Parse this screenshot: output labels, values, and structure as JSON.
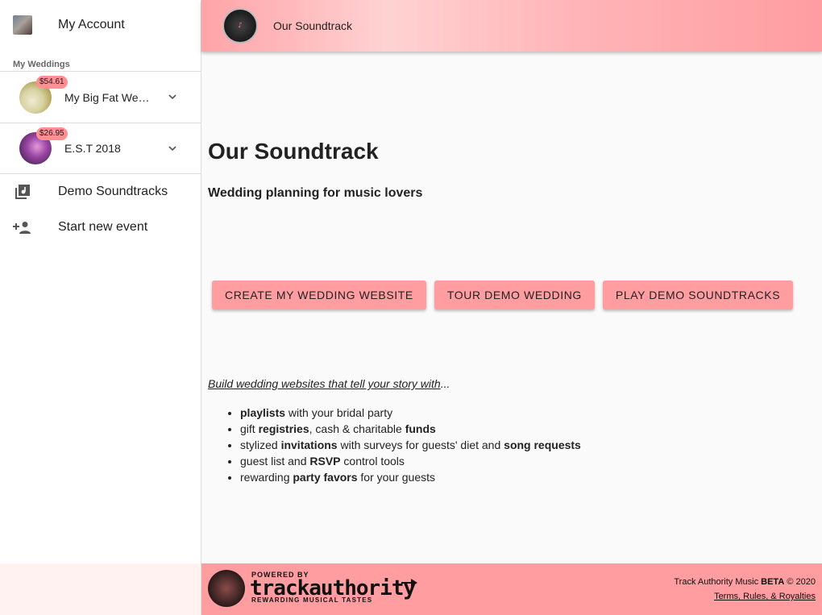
{
  "sidebar": {
    "account_label": "My Account",
    "section_title": "My Weddings",
    "weddings": [
      {
        "name": "My Big Fat Wedding",
        "price": "$54.61"
      },
      {
        "name": "E.S.T 2018",
        "price": "$26.95"
      }
    ],
    "nav": [
      {
        "label": "Demo Soundtracks",
        "icon": "library-music-icon"
      },
      {
        "label": "Start new event",
        "icon": "person-add-icon"
      }
    ]
  },
  "header": {
    "title": "Our Soundtrack"
  },
  "main": {
    "title": "Our Soundtrack",
    "subtitle": "Wedding planning for music lovers",
    "buttons": [
      "CREATE MY WEDDING WEBSITE",
      "TOUR DEMO WEDDING",
      "PLAY DEMO SOUNDTRACKS"
    ],
    "tagline": "Build wedding websites that tell your story with",
    "tagline_suffix": "...",
    "features": [
      [
        {
          "t": "playlists",
          "b": true
        },
        {
          "t": " with your bridal party",
          "b": false
        }
      ],
      [
        {
          "t": "gift ",
          "b": false
        },
        {
          "t": "registries",
          "b": true
        },
        {
          "t": ", cash & charitable ",
          "b": false
        },
        {
          "t": "funds",
          "b": true
        }
      ],
      [
        {
          "t": "stylized ",
          "b": false
        },
        {
          "t": "invitations",
          "b": true
        },
        {
          "t": " with surveys for guests' diet and ",
          "b": false
        },
        {
          "t": "song requests",
          "b": true
        }
      ],
      [
        {
          "t": "guest list and ",
          "b": false
        },
        {
          "t": "RSVP",
          "b": true
        },
        {
          "t": " control tools",
          "b": false
        }
      ],
      [
        {
          "t": "rewarding ",
          "b": false
        },
        {
          "t": "party favors",
          "b": true
        },
        {
          "t": " for your guests",
          "b": false
        }
      ]
    ]
  },
  "footer": {
    "powered_by": "POWERED BY",
    "brand": "trackauthority",
    "slogan": "REWARDING MUSICAL TASTES",
    "copyright_prefix": "Track Authority Music ",
    "copyright_bold": "BETA",
    "copyright_suffix": " © 2020",
    "terms_link": "Terms, Rules, & Royalties"
  },
  "colors": {
    "accent": "#ff9da1",
    "badge": "#ff8f94"
  }
}
